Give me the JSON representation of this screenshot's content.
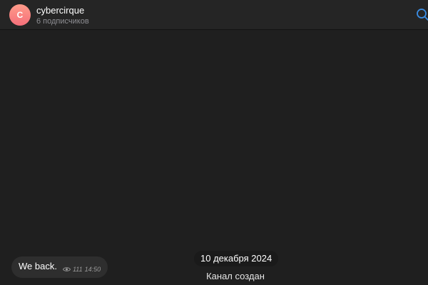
{
  "header": {
    "avatar_letter": "C",
    "channel_name": "cybercirque",
    "subscribers": "6 подписчиков",
    "avatar_color": "#f77f7f",
    "search_icon": "search-icon",
    "accent_color": "#3a8ee6"
  },
  "feed": {
    "date_chip": "10 декабря 2024",
    "service_message": "Канал создан",
    "messages": [
      {
        "text": "We back.",
        "views": "111",
        "time": "14:50",
        "views_icon": "eye-icon"
      }
    ]
  }
}
